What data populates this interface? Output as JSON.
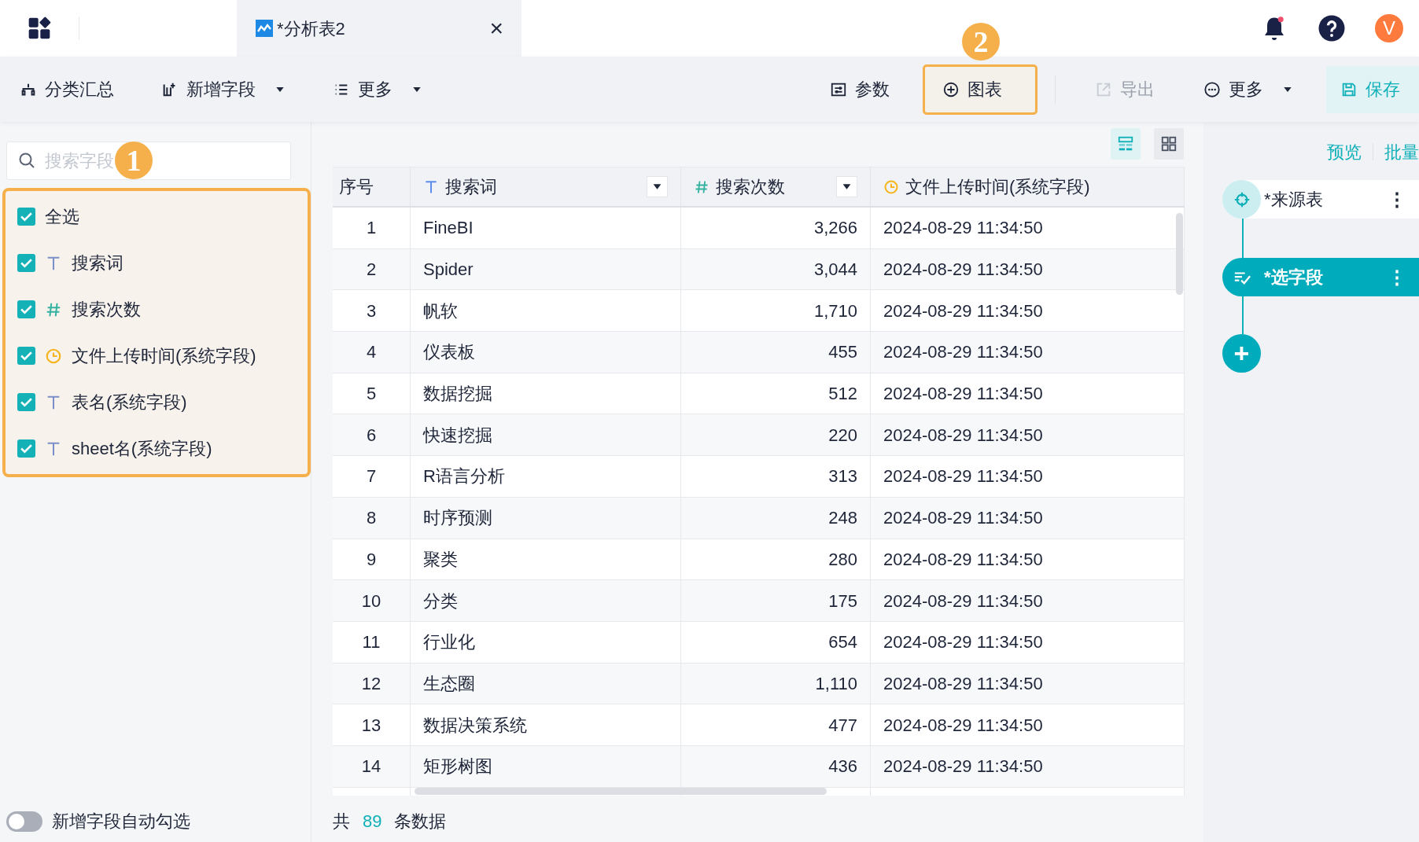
{
  "top_bar": {
    "tab": {
      "title": "*分析表2",
      "close": "×"
    },
    "avatar": "V"
  },
  "toolbar": {
    "left": [
      {
        "label": "分类汇总",
        "dropdown": false
      },
      {
        "label": "新增字段",
        "dropdown": true
      },
      {
        "label": "更多",
        "dropdown": true
      }
    ],
    "right": [
      {
        "label": "参数",
        "kind": "plain"
      },
      {
        "label": "图表",
        "kind": "highlighted",
        "callout": "2"
      },
      {
        "label": "导出",
        "kind": "disabled"
      },
      {
        "label": "更多",
        "kind": "dropdown"
      },
      {
        "label": "保存",
        "kind": "primary"
      }
    ]
  },
  "field_panel": {
    "search": {
      "placeholder": "搜索字段"
    },
    "callout": "1",
    "fields": [
      {
        "label": "全选",
        "kind": "all",
        "checked": true
      },
      {
        "label": "搜索词",
        "kind": "text",
        "checked": true
      },
      {
        "label": "搜索次数",
        "kind": "number",
        "checked": true
      },
      {
        "label": "文件上传时间(系统字段)",
        "kind": "date",
        "checked": true
      },
      {
        "label": "表名(系统字段)",
        "kind": "text",
        "checked": true
      },
      {
        "label": "sheet名(系统字段)",
        "kind": "text",
        "checked": true
      }
    ],
    "auto_select": {
      "label": "新增字段自动勾选",
      "on": false
    }
  },
  "table": {
    "views": [
      {
        "kind": "list",
        "selected": true
      },
      {
        "kind": "grid",
        "selected": false
      }
    ],
    "columns": [
      {
        "label": "序号",
        "kind": "index"
      },
      {
        "label": "搜索词",
        "kind": "text"
      },
      {
        "label": "搜索次数",
        "kind": "number"
      },
      {
        "label": "文件上传时间(系统字段)",
        "kind": "date"
      }
    ],
    "rows": [
      [
        "1",
        "FineBI",
        "3,266",
        "2024-08-29 11:34:50"
      ],
      [
        "2",
        "Spider",
        "3,044",
        "2024-08-29 11:34:50"
      ],
      [
        "3",
        "帆软",
        "1,710",
        "2024-08-29 11:34:50"
      ],
      [
        "4",
        "仪表板",
        "455",
        "2024-08-29 11:34:50"
      ],
      [
        "5",
        "数据挖掘",
        "512",
        "2024-08-29 11:34:50"
      ],
      [
        "6",
        "快速挖掘",
        "220",
        "2024-08-29 11:34:50"
      ],
      [
        "7",
        "R语言分析",
        "313",
        "2024-08-29 11:34:50"
      ],
      [
        "8",
        "时序预测",
        "248",
        "2024-08-29 11:34:50"
      ],
      [
        "9",
        "聚类",
        "280",
        "2024-08-29 11:34:50"
      ],
      [
        "10",
        "分类",
        "175",
        "2024-08-29 11:34:50"
      ],
      [
        "11",
        "行业化",
        "654",
        "2024-08-29 11:34:50"
      ],
      [
        "12",
        "生态圈",
        "1,110",
        "2024-08-29 11:34:50"
      ],
      [
        "13",
        "数据决策系统",
        "477",
        "2024-08-29 11:34:50"
      ],
      [
        "14",
        "矩形树图",
        "436",
        "2024-08-29 11:34:50"
      ]
    ],
    "footer": {
      "prefix": "共",
      "count": "89",
      "suffix": "条数据"
    }
  },
  "right_panel": {
    "links": [
      "预览",
      "批量"
    ],
    "steps": [
      {
        "label": "*来源表",
        "kind": "source",
        "selected": false,
        "menu": "⋮"
      },
      {
        "label": "*选字段",
        "kind": "select",
        "selected": true,
        "menu": "⋮"
      }
    ],
    "add": "+"
  }
}
